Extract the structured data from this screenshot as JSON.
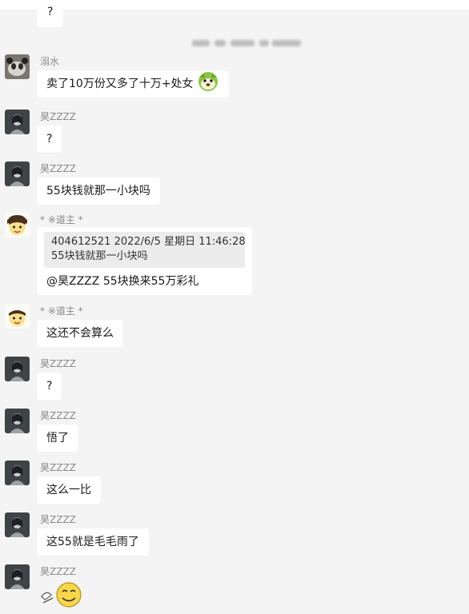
{
  "messages": [
    {
      "text": "?"
    },
    {
      "name": "溺水",
      "text": "卖了10万份又多了十万+处女"
    },
    {
      "name": "昊ZZZZ",
      "text": "?"
    },
    {
      "name": "昊ZZZZ",
      "text": "55块钱就那一小块吗"
    },
    {
      "name": "* ※道主 *",
      "quote_line1": "404612521  2022/6/5 星期日 11:46:28",
      "quote_line2": "55块钱就那一小块吗",
      "text": "@昊ZZZZ 55块换来55万彩礼"
    },
    {
      "name": "* ※道主 *",
      "text": "这还不会算么"
    },
    {
      "name": "昊ZZZZ",
      "text": "?"
    },
    {
      "name": "昊ZZZZ",
      "text": "悟了"
    },
    {
      "name": "昊ZZZZ",
      "text": "这么一比"
    },
    {
      "name": "昊ZZZZ",
      "text": "这55就是毛毛雨了"
    },
    {
      "name": "昊ZZZZ"
    }
  ],
  "icons": {
    "emoji_inline": "green-dog-emoji-icon",
    "sticker": "smiley-emoji-sticker-icon"
  }
}
